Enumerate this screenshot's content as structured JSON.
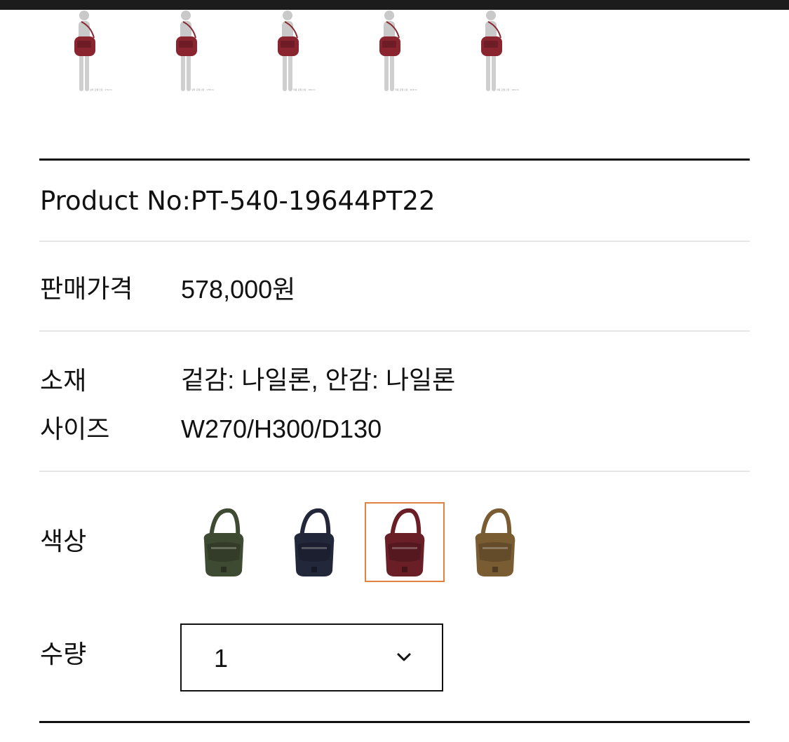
{
  "model_shots": [
    {
      "caption": "실착 모델 신장 : 170cm"
    },
    {
      "caption": "실착 모델 신장 : 178cm"
    },
    {
      "caption": "착용 모델 신장 : 160cm"
    },
    {
      "caption": "착용 모델 신장 : 163cm"
    },
    {
      "caption": "착용 모델 신장 : 160cm"
    }
  ],
  "product": {
    "number": "Product No:PT-540-19644PT22",
    "price_label": "판매가격",
    "price_value": "578,000원",
    "material_label": "소재",
    "material_value": "겉감: 나일론, 안감: 나일론",
    "size_label": "사이즈",
    "size_value": "W270/H300/D130"
  },
  "color": {
    "label": "색상",
    "options": [
      {
        "name": "olive",
        "hex": "#3f4a32",
        "selected": false
      },
      {
        "name": "navy",
        "hex": "#23273a",
        "selected": false
      },
      {
        "name": "burgundy",
        "hex": "#6a1e26",
        "selected": true
      },
      {
        "name": "khaki",
        "hex": "#7a5c32",
        "selected": false
      }
    ],
    "selected_border": "#e2823f"
  },
  "quantity": {
    "label": "수량",
    "value": "1"
  },
  "colors": {
    "topbar": "#1c1c1c",
    "divider_thick": "#111111",
    "divider_thin": "#e6e6e6",
    "bag_model": "#8a2530"
  }
}
